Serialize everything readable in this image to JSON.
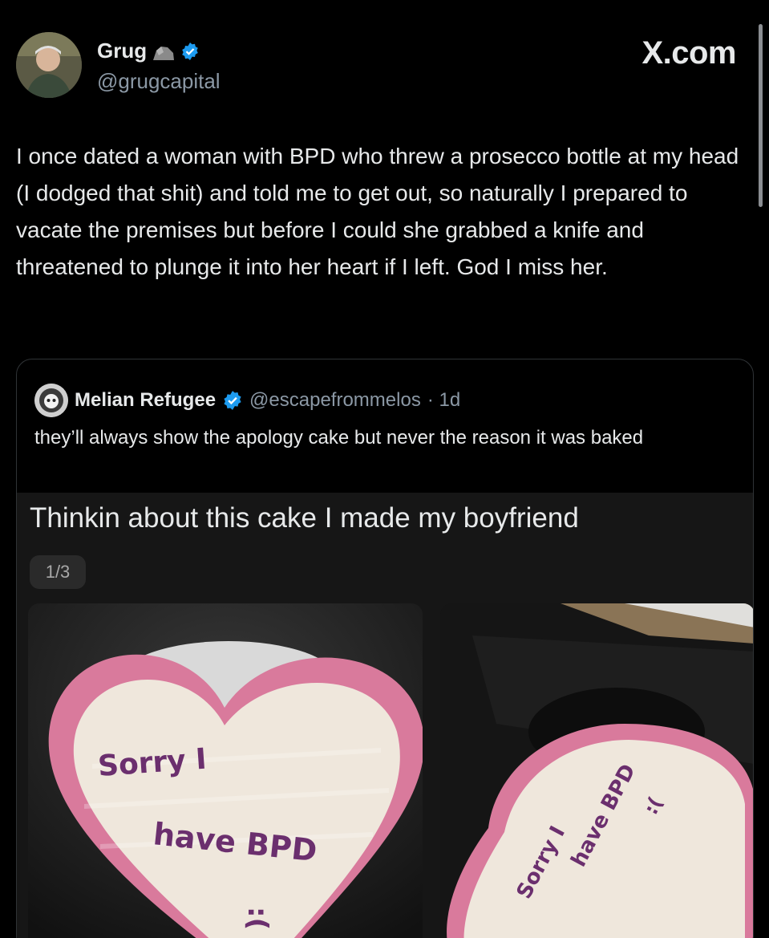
{
  "post": {
    "author_name": "Grug",
    "author_handle": "@grugcapital",
    "brand": "X.com",
    "text": "I once dated a woman with BPD who threw a prosecco bottle at my head (I dodged that shit) and told me to get out, so naturally I prepared to vacate the premises but before I could she grabbed a knife and threatened to plunge it into her heart if I left. God I miss her."
  },
  "quote": {
    "author_name": "Melian Refugee",
    "author_handle": "@escapefrommelos",
    "time": "· 1d",
    "text": "they’ll always show the apology cake but never the reason it was baked",
    "embed_title": "Thinkin about this cake I made my boyfriend",
    "counter": "1/3",
    "cake1": {
      "line1": "Sorry I",
      "line2": "have BPD",
      "face": ":("
    },
    "cake2": {
      "line1": "Sorry I",
      "line2": "have BPD",
      "face": ":("
    }
  },
  "colors": {
    "verified": "#1d9bf0",
    "frosting": "#d97a9c",
    "icing_text": "#6b2f6e"
  },
  "icons": {
    "verified": "verified-badge-icon",
    "rock": "rock-icon"
  }
}
